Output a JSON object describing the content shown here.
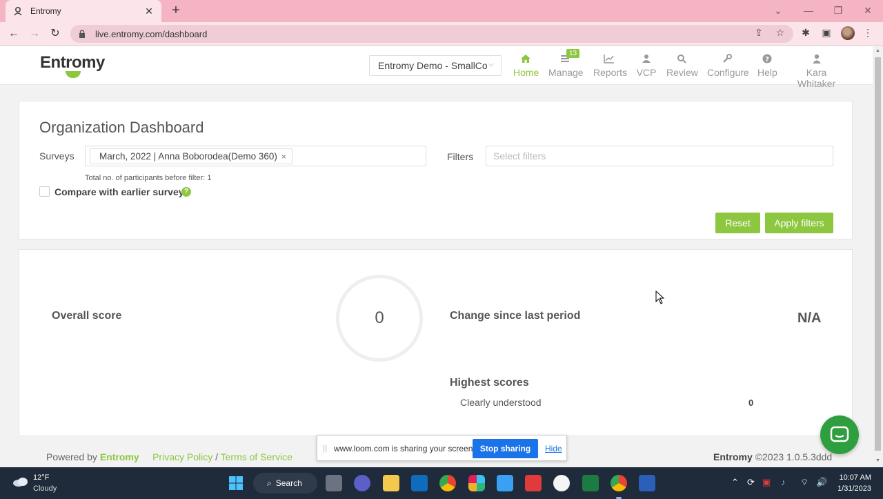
{
  "browser": {
    "tab_title": "Entromy",
    "url": "live.entromy.com/dashboard"
  },
  "app": {
    "logo": "Entromy",
    "org_select": "Entromy Demo - SmallCo",
    "nav": [
      {
        "label": "Home",
        "icon": "home-icon",
        "active": true
      },
      {
        "label": "Manage",
        "icon": "list-icon",
        "badge": "13"
      },
      {
        "label": "Reports",
        "icon": "chart-icon"
      },
      {
        "label": "VCP",
        "icon": "people-icon"
      },
      {
        "label": "Review",
        "icon": "search-icon"
      },
      {
        "label": "Configure",
        "icon": "wrench-icon"
      },
      {
        "label": "Help",
        "icon": "question-icon"
      },
      {
        "label": "Kara Whitaker",
        "icon": "user-icon"
      }
    ],
    "accent_color": "#8dc63f"
  },
  "dashboard": {
    "title": "Organization Dashboard",
    "surveys_label": "Surveys",
    "survey_chip": "March, 2022 | Anna Boborodea(Demo 360)",
    "survey_chip_remove": "×",
    "filters_label": "Filters",
    "filters_placeholder": "Select filters",
    "participants_note": "Total no. of participants before filter: 1",
    "compare_label": "Compare with earlier survey",
    "compare_help": "?",
    "reset_label": "Reset",
    "apply_label": "Apply filters"
  },
  "scores": {
    "overall_label": "Overall score",
    "overall_value": "0",
    "change_label": "Change since last period",
    "change_value": "N/A",
    "highest_label": "Highest scores",
    "highest_items": [
      {
        "label": "Clearly understood",
        "value": "0"
      }
    ]
  },
  "footer": {
    "powered_by": "Powered by",
    "brand": "Entromy",
    "privacy": "Privacy Policy",
    "sep": "/",
    "terms": "Terms of Service",
    "brand_right": "Entromy",
    "copyright": "©2023 1.0.5.3ddd"
  },
  "loom": {
    "text": "www.loom.com is sharing your screen.",
    "stop": "Stop sharing",
    "hide": "Hide"
  },
  "taskbar": {
    "temp": "12°F",
    "weather": "Cloudy",
    "search": "Search",
    "time": "10:07 AM",
    "date": "1/31/2023"
  }
}
